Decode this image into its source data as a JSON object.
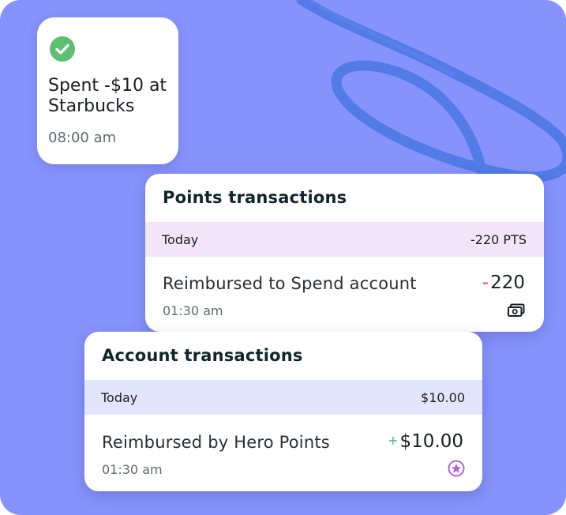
{
  "colors": {
    "background": "#8793fc",
    "scribble": "#4f79e6",
    "success_green": "#5cbf71",
    "points_band": "#f2e5f9",
    "account_band": "#e3e5fc",
    "negative_red": "#e2463a",
    "positive_green": "#4bb970",
    "star_purple": "#b064d8"
  },
  "notification": {
    "icon": "check-circle-icon",
    "title": "Spent -$10 at Starbucks",
    "time": "08:00 am"
  },
  "points_card": {
    "title": "Points transactions",
    "group": {
      "label": "Today",
      "total": "-220 PTS"
    },
    "items": [
      {
        "label": "Reimbursed to Spend account",
        "time": "01:30 am",
        "sign": "-",
        "amount": "220",
        "icon": "cash-icon"
      }
    ]
  },
  "account_card": {
    "title": "Account transactions",
    "group": {
      "label": "Today",
      "total": "$10.00"
    },
    "items": [
      {
        "label": "Reimbursed by Hero Points",
        "time": "01:30 am",
        "sign": "+",
        "amount": "$10.00",
        "icon": "star-circle-icon"
      }
    ]
  }
}
